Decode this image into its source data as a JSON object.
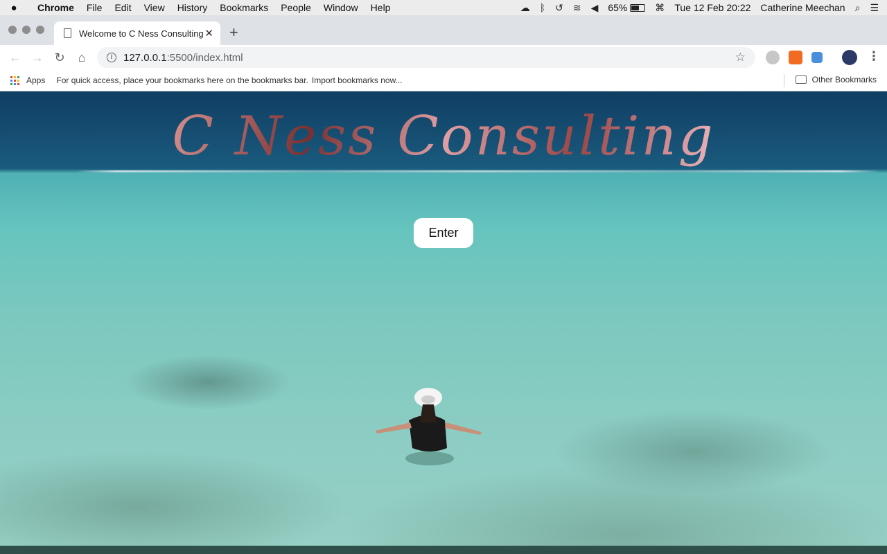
{
  "menubar": {
    "app": "Chrome",
    "items": [
      "File",
      "Edit",
      "View",
      "History",
      "Bookmarks",
      "People",
      "Window",
      "Help"
    ],
    "battery_percent": "65%",
    "battery_level": 0.65,
    "datetime": "Tue 12 Feb  20:22",
    "user": "Catherine Meechan"
  },
  "tab": {
    "title": "Welcome to C Ness Consulting",
    "close": "✕",
    "new_tab": "+"
  },
  "toolbar": {
    "url_host": "127.0.0.1",
    "url_path": ":5500/index.html"
  },
  "bookmarks": {
    "apps_label": "Apps",
    "hint": "For quick access, place your bookmarks here on the bookmarks bar.",
    "import_link": "Import bookmarks now...",
    "other": "Other Bookmarks"
  },
  "page": {
    "title": "C Ness Consulting",
    "enter_label": "Enter"
  },
  "colors": {
    "ocean_deep": "#103e63",
    "lagoon": "#66c4be",
    "title_rose": "#d08a8a"
  }
}
